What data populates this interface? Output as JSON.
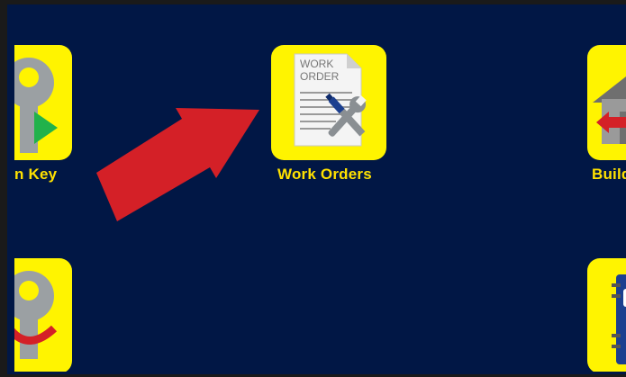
{
  "apps": {
    "key_label": "n Key",
    "work_orders_label": "Work Orders",
    "buildings_label": "Build"
  },
  "colors": {
    "background": "#011745",
    "tile": "#fff400",
    "label": "#ffe100",
    "arrow": "#d42027"
  },
  "icons": {
    "key": "key-icon",
    "work_order": "work-order-document-icon",
    "building": "building-icon",
    "notebook": "notebook-icon",
    "pointer": "red-arrow"
  },
  "work_order_doc": {
    "line1": "WORK",
    "line2": "ORDER"
  }
}
